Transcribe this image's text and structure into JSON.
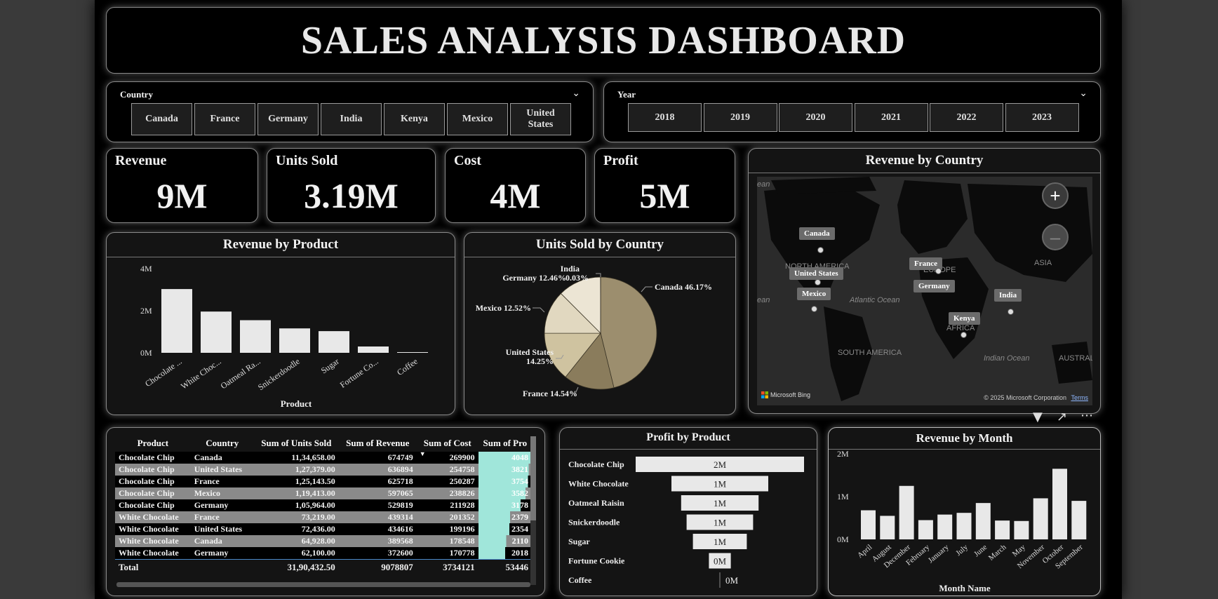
{
  "title": "SALES ANALYSIS DASHBOARD",
  "country_slicer": {
    "label": "Country",
    "options": [
      "Canada",
      "France",
      "Germany",
      "India",
      "Kenya",
      "Mexico",
      "United States"
    ]
  },
  "year_slicer": {
    "label": "Year",
    "options": [
      "2018",
      "2019",
      "2020",
      "2021",
      "2022",
      "2023"
    ]
  },
  "kpis": [
    {
      "label": "Revenue",
      "value": "9M"
    },
    {
      "label": "Units Sold",
      "value": "3.19M"
    },
    {
      "label": "Cost",
      "value": "4M"
    },
    {
      "label": "Profit",
      "value": "5M"
    }
  ],
  "map": {
    "title": "Revenue by Country",
    "countries": [
      "Canada",
      "United States",
      "Mexico",
      "France",
      "Germany",
      "India",
      "Kenya"
    ],
    "region_labels": [
      "NORTH AMERICA",
      "EUROPE",
      "ASIA",
      "AFRICA",
      "SOUTH AMERICA",
      "Atlantic Ocean",
      "Indian Ocean",
      "AUSTRALI",
      "ean",
      "ean"
    ],
    "bing_label": "Microsoft Bing",
    "copyright": "© 2025 Microsoft Corporation",
    "terms": "Terms"
  },
  "revenue_by_product": {
    "chart_data": {
      "type": "bar",
      "title": "Revenue by Product",
      "xlabel": "Product",
      "ylabel": "",
      "categories": [
        "Chocolate ...",
        "White Choc...",
        "Oatmeal Ra...",
        "Snickerdoodle",
        "Sugar",
        "Fortune Co...",
        "Coffee"
      ],
      "values": [
        3.03,
        1.96,
        1.55,
        1.16,
        1.03,
        0.3,
        0.005
      ],
      "y_ticks": [
        "4M",
        "2M",
        "0M"
      ],
      "ylim": [
        0,
        4
      ]
    }
  },
  "units_by_country": {
    "chart_data": {
      "type": "pie",
      "title": "Units Sold by Country",
      "slices": [
        {
          "label": "Canada 46.17%",
          "value": 46.17,
          "color": "#9c8e6e"
        },
        {
          "label": "France 14.54%",
          "value": 14.54,
          "color": "#8a7c5c"
        },
        {
          "label": "United States 14.25%",
          "value": 14.25,
          "color": "#cfc3a0"
        },
        {
          "label": "Mexico 12.52%",
          "value": 12.52,
          "color": "#e1d8c0"
        },
        {
          "label": "Germany 12.46%",
          "value": 12.46,
          "color": "#ece5d4"
        },
        {
          "label": "India 0.03%",
          "value": 0.03,
          "color": "#f3efe4"
        }
      ],
      "label_lines": {
        "canada": "Canada 46.17%",
        "france": "France 14.54%",
        "us_1": "United States",
        "us_2": "14.25%",
        "mexico": "Mexico 12.52%",
        "germany": "Germany 12.46%",
        "india_1": "India",
        "india_2": "0.03%"
      }
    }
  },
  "table": {
    "headers": [
      "Product",
      "Country",
      "Sum of Units Sold",
      "Sum of Revenue",
      "Sum of Cost",
      "Sum of Pro"
    ],
    "rows": [
      [
        "Chocolate Chip",
        "Canada",
        "11,34,658.00",
        "674749",
        "269900",
        "4048"
      ],
      [
        "Chocolate Chip",
        "United States",
        "1,27,379.00",
        "636894",
        "254758",
        "3821"
      ],
      [
        "Chocolate Chip",
        "France",
        "1,25,143.50",
        "625718",
        "250287",
        "3754"
      ],
      [
        "Chocolate Chip",
        "Mexico",
        "1,19,413.00",
        "597065",
        "238826",
        "3582"
      ],
      [
        "Chocolate Chip",
        "Germany",
        "1,05,964.00",
        "529819",
        "211928",
        "3178"
      ],
      [
        "White Chocolate",
        "France",
        "73,219.00",
        "439314",
        "201352",
        "2379"
      ],
      [
        "White Chocolate",
        "United States",
        "72,436.00",
        "434616",
        "199196",
        "2354"
      ],
      [
        "White Chocolate",
        "Canada",
        "64,928.00",
        "389568",
        "178548",
        "2110"
      ],
      [
        "White Chocolate",
        "Germany",
        "62,100.00",
        "372600",
        "170778",
        "2018"
      ]
    ],
    "profit_fraction": [
      1.0,
      0.94,
      0.93,
      0.88,
      0.79,
      0.59,
      0.58,
      0.52,
      0.5
    ],
    "total": [
      "Total",
      "",
      "31,90,432.50",
      "9078807",
      "3734121",
      "53446"
    ]
  },
  "profit_by_product": {
    "chart_data": {
      "type": "bar",
      "title": "Profit by Product",
      "orientation": "horizontal",
      "categories": [
        "Chocolate Chip",
        "White Chocolate",
        "Oatmeal Raisin",
        "Snickerdoodle",
        "Sugar",
        "Fortune Cookie",
        "Coffee"
      ],
      "values": [
        2.0,
        1.15,
        0.92,
        0.79,
        0.64,
        0.26,
        0.0
      ],
      "labels": [
        "2M",
        "1M",
        "1M",
        "1M",
        "1M",
        "0M",
        "0M"
      ]
    }
  },
  "revenue_by_month": {
    "chart_data": {
      "type": "bar",
      "title": "Revenue by Month",
      "xlabel": "Month Name",
      "ylabel": "",
      "categories": [
        "April",
        "August",
        "December",
        "February",
        "January",
        "July",
        "June",
        "March",
        "May",
        "November",
        "October",
        "September"
      ],
      "values": [
        0.68,
        0.55,
        1.25,
        0.45,
        0.58,
        0.62,
        0.85,
        0.44,
        0.43,
        0.96,
        1.65,
        0.9
      ],
      "y_ticks": [
        "2M",
        "1M",
        "0M"
      ],
      "ylim": [
        0,
        2
      ]
    }
  },
  "colors": {
    "accent": "#a0e6da",
    "bar": "#e8e8e8",
    "row_alt": "#8a8a8a"
  }
}
